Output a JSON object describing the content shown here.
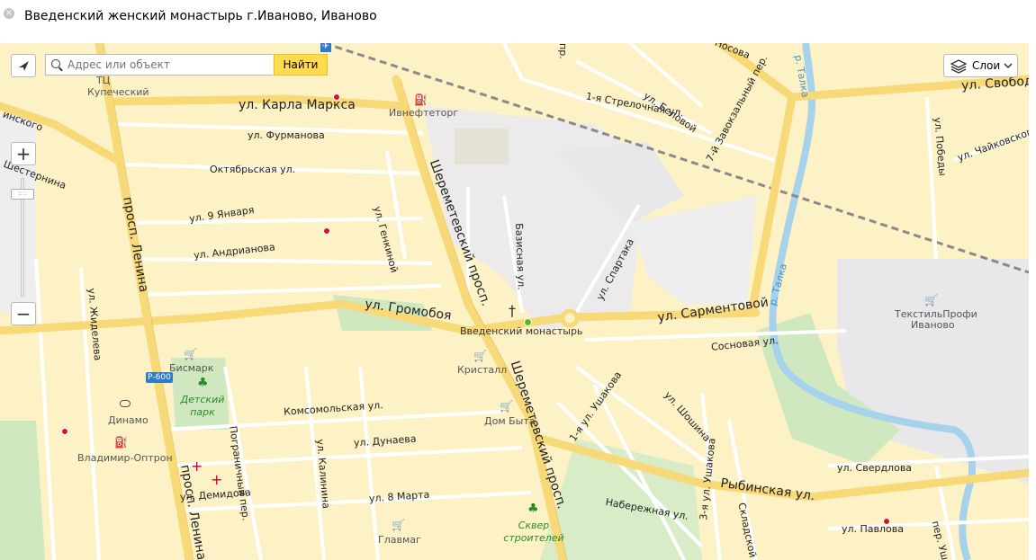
{
  "header": {
    "title": "Введенский женский монастырь г.Иваново, Иваново",
    "close_icon": "close-icon"
  },
  "search": {
    "placeholder": "Адрес или объект",
    "button": "Найти"
  },
  "layers": {
    "label": "Слои"
  },
  "zoom": {
    "plus": "+",
    "minus": "−"
  },
  "streets": {
    "karla_marksa": "ул. Карла Маркса",
    "furmanova": "ул. Фурманова",
    "oktyabrskaya": "Октябрьская ул.",
    "genkinoy": "ул. Генкиной",
    "devyatogo_yanvarya": "ул. 9 Января",
    "andrianova": "ул. Андрианова",
    "gromoboya": "ул. Громобоя",
    "lenina_1": "просп. Ленина",
    "lenina_2": "просп. Ленина",
    "sheremetevsky_1": "Шереметевский просп.",
    "sheremetevsky_2": "Шереметевский просп.",
    "zhideleva": "ул. Жиделева",
    "shesternina": "Шестернина",
    "komsomolskaya": "Комсомольская ул.",
    "dunaeva": "ул. Дунаева",
    "demidova": "ул. Демидова",
    "vosmogo_marta": "ул. 8 Марта",
    "pogranichny": "Пограничный пер.",
    "kalinina": "ул. Калинина",
    "bazisnaya": "Базисная ул.",
    "spartaka": "ул. Спартака",
    "sarmentovoy": "ул. Сарментовой",
    "sosnovaya": "Сосновая ул.",
    "ushakova_1": "1-я ул. Ушакова",
    "ushakova_3": "3-я ул. Ушакова",
    "shoshina": "ул. Шошина",
    "rybinskaya": "Рыбинская ул.",
    "naberezhnaya": "Набережная ул.",
    "skladskoy": "Складской пер.",
    "sverdlova": "ул. Свердлова",
    "pavlova": "ул. Павлова",
    "ushakova_per": "пер. Ушако",
    "strelochnaya": "1-я Стрелочная ул.",
    "belovoy": "ул. Беловой",
    "zavokzalny": "7-й Завокзальный пер.",
    "nosova": "Носова",
    "svobody": "ул. Свобод",
    "pobedy": "ул. Победы",
    "chaykovskogo": "ул. Чайковского",
    "talka_1": "р. Талка",
    "talka_2": "р. Талка",
    "pr_fragment": "пр.",
    "inskogo": "инского"
  },
  "pois": {
    "monastery": "Введенский монастырь",
    "ivneftetorg": "Ивнефтеторг",
    "kupechesky": "Купеческий",
    "tts": "ТЦ",
    "bismark": "Бисмарк",
    "detsky_park": "Детский парк",
    "kristall": "Кристалл",
    "dom_byta": "Дом Быта",
    "dinamo": "Динамо",
    "vladimir_optron": "Владимир-Оптрон",
    "glavmag": "Главмаг",
    "skver": "Сквер строителей",
    "tekstil_1": "ТекстильПрофи",
    "tekstil_2": "Иваново",
    "r600": "Р-600"
  },
  "colors": {
    "background": "#fdf2c6",
    "main_road": "#f8d978",
    "railway": "#8a8a8a",
    "river": "#a6d2ec",
    "park": "#cfe8c0",
    "industrial": "#e8e8ea",
    "find_button": "#ffdb4d"
  }
}
